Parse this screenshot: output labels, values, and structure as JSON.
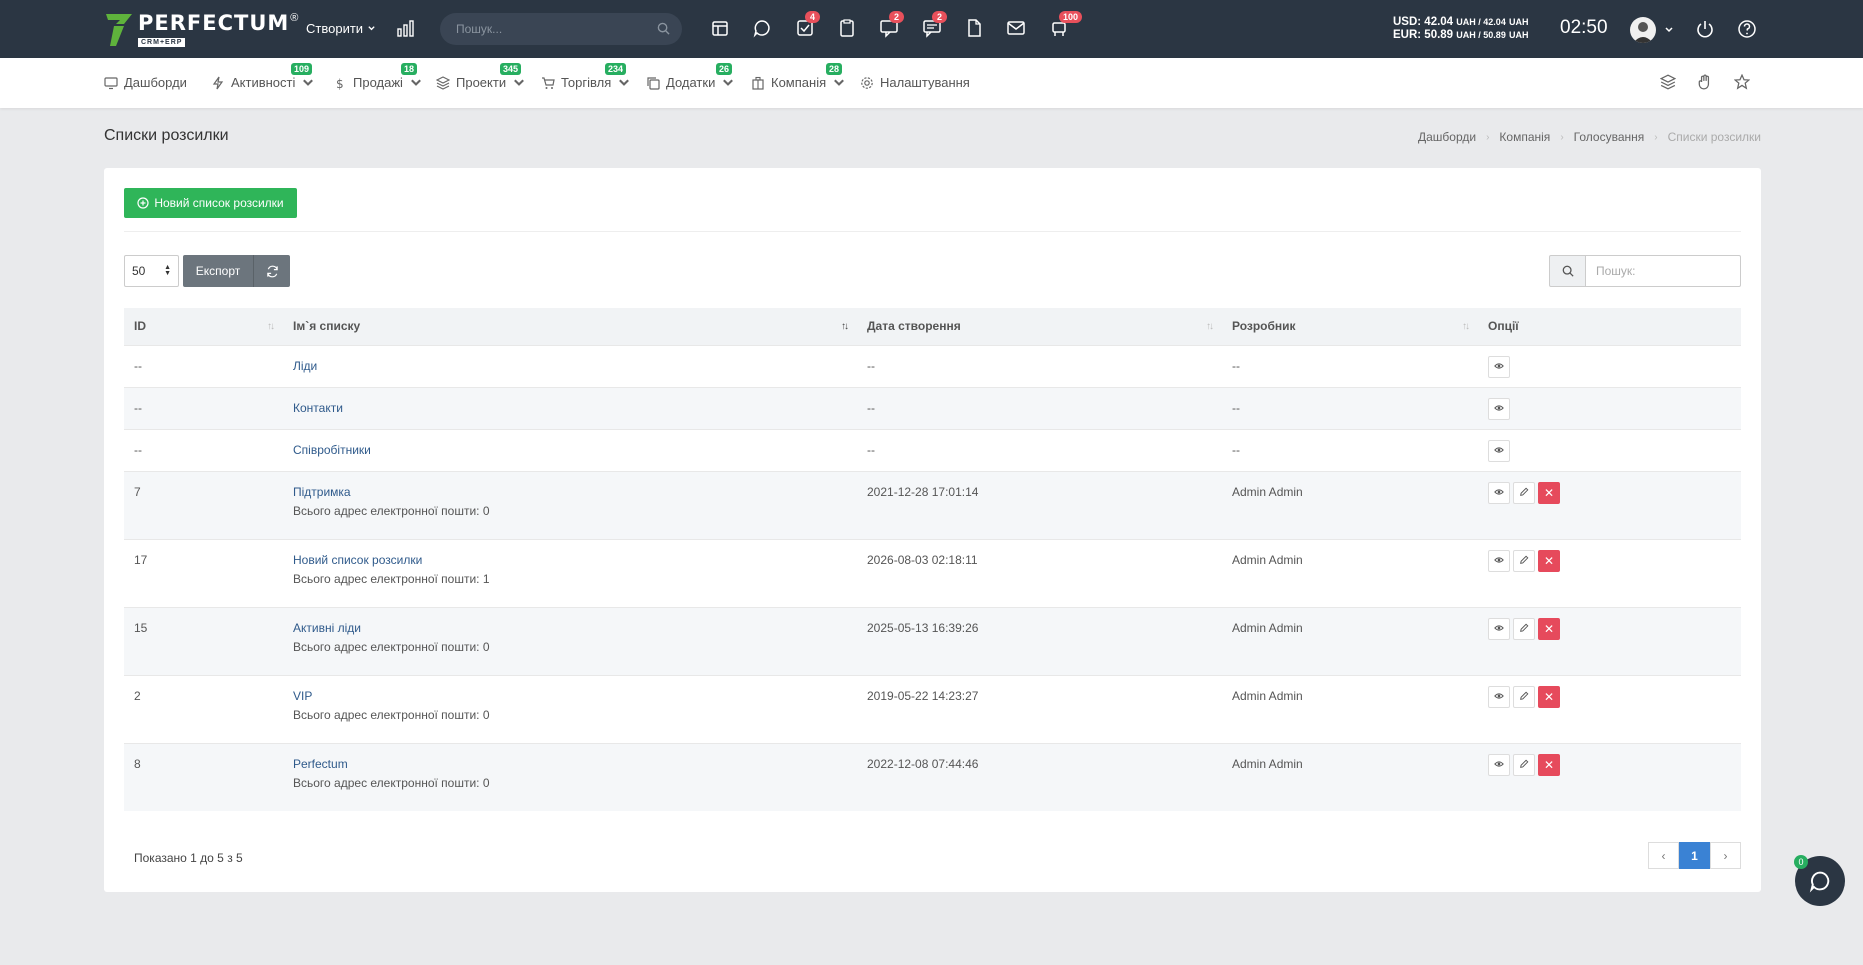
{
  "topbar": {
    "logo_text": "PERFECTUM",
    "logo_sub": "CRM+ERP",
    "logo_reg": "®",
    "create_label": "Створити",
    "search_placeholder": "Пошук...",
    "badges": {
      "tasks": "4",
      "messages": "2",
      "chat": "2",
      "notifications": "100"
    },
    "currency_usd": "USD: 42.04",
    "currency_usd_unit": "UAH / 42.04",
    "currency_usd_unit2": "UAH",
    "currency_eur": "EUR: 50.89",
    "currency_eur_unit": "UAH / 50.89",
    "currency_eur_unit2": "UAH",
    "clock": "02:50"
  },
  "nav": {
    "items": [
      {
        "label": "Дашборди",
        "icon": "monitor-icon",
        "badge": ""
      },
      {
        "label": "Активності",
        "icon": "bolt-icon",
        "badge": "109"
      },
      {
        "label": "Продажі",
        "icon": "dollar-icon",
        "badge": "18"
      },
      {
        "label": "Проекти",
        "icon": "layers-icon",
        "badge": "345"
      },
      {
        "label": "Торгівля",
        "icon": "cart-icon",
        "badge": "234"
      },
      {
        "label": "Додатки",
        "icon": "copy-icon",
        "badge": "26"
      },
      {
        "label": "Компанія",
        "icon": "building-icon",
        "badge": "28"
      },
      {
        "label": "Налаштування",
        "icon": "gear-icon",
        "badge": ""
      }
    ]
  },
  "page": {
    "title": "Списки розсилки",
    "breadcrumb": [
      "Дашборди",
      "Компанія",
      "Голосування",
      "Списки розсилки"
    ]
  },
  "toolbar": {
    "new_label": "Новий список розсилки",
    "page_length": "50",
    "export_label": "Експорт",
    "search_placeholder": "Пошук:"
  },
  "table": {
    "columns": [
      "ID",
      "Ім`я списку",
      "Дата створення",
      "Розробник",
      "Опції"
    ],
    "rows": [
      {
        "id": "--",
        "name": "Ліди",
        "sub": "",
        "date": "--",
        "author": "--",
        "editable": false
      },
      {
        "id": "--",
        "name": "Контакти",
        "sub": "",
        "date": "--",
        "author": "--",
        "editable": false
      },
      {
        "id": "--",
        "name": "Співробітники",
        "sub": "",
        "date": "--",
        "author": "--",
        "editable": false
      },
      {
        "id": "7",
        "name": "Підтримка",
        "sub": "Всього адрес електронної пошти: 0",
        "date": "2021-12-28 17:01:14",
        "author": "Admin Admin",
        "editable": true
      },
      {
        "id": "17",
        "name": "Новий список розсилки",
        "sub": "Всього адрес електронної пошти: 1",
        "date": "2026-08-03 02:18:11",
        "author": "Admin Admin",
        "editable": true
      },
      {
        "id": "15",
        "name": "Активні ліди",
        "sub": "Всього адрес електронної пошти: 0",
        "date": "2025-05-13 16:39:26",
        "author": "Admin Admin",
        "editable": true
      },
      {
        "id": "2",
        "name": "VIP",
        "sub": "Всього адрес електронної пошти: 0",
        "date": "2019-05-22 14:23:27",
        "author": "Admin Admin",
        "editable": true
      },
      {
        "id": "8",
        "name": "Perfectum",
        "sub": "Всього адрес електронної пошти: 0",
        "date": "2022-12-08 07:44:46",
        "author": "Admin Admin",
        "editable": true
      }
    ]
  },
  "footer": {
    "showing": "Показано 1 до 5 з 5",
    "current_page": "1",
    "chat_count": "0"
  }
}
